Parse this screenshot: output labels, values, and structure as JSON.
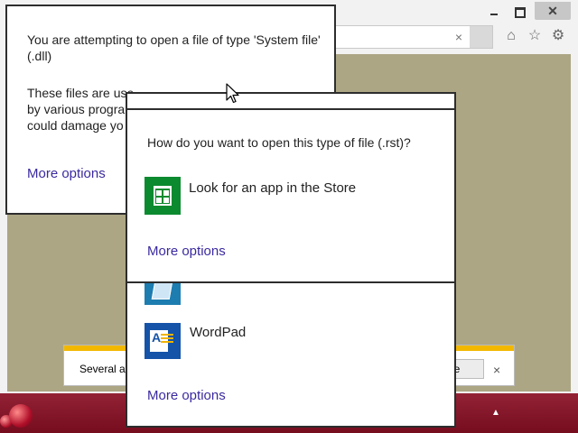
{
  "browser": {
    "address_clear_glyph": "×",
    "icons": [
      "minimize-icon",
      "maximize-icon",
      "close-icon",
      "home-icon",
      "star-icon",
      "gear-icon"
    ]
  },
  "notification": {
    "text": "Several ad",
    "button_label": "le",
    "close_glyph": "×",
    "stripe_color": "#f2b800"
  },
  "taskbar": {
    "color": "#8a0f24",
    "tray_arrow": "▲"
  },
  "dialog_dll": {
    "line1": "You are attempting to open a file of type 'System file' (.dll)",
    "line2a": "These files are use",
    "line2b": "by various progra",
    "line2c": "could damage yo",
    "more_options": "More options"
  },
  "dialog_rst": {
    "question": "How do you want to open this type of file (.rst)?",
    "store_option": "Look for an app in the Store",
    "more_options": "More options",
    "accent": "#3a2aa0",
    "store_color": "#0b8a2f"
  },
  "dialog_apps": {
    "wordpad": "WordPad",
    "more_options": "More options"
  }
}
